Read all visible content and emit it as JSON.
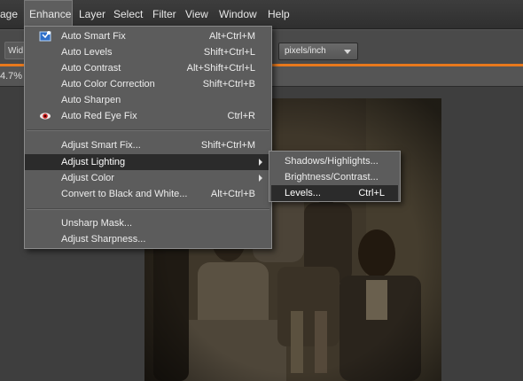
{
  "menubar": {
    "items": [
      {
        "label": "age",
        "active": false
      },
      {
        "label": "Enhance",
        "active": true
      },
      {
        "label": "Layer",
        "active": false
      },
      {
        "label": "Select",
        "active": false
      },
      {
        "label": "Filter",
        "active": false
      },
      {
        "label": "View",
        "active": false
      },
      {
        "label": "Window",
        "active": false
      },
      {
        "label": "Help",
        "active": false
      }
    ]
  },
  "options": {
    "width_label": "Wid",
    "resolution_units": "pixels/inch"
  },
  "tabs": {
    "zoom": "4.7%"
  },
  "enhance_menu": {
    "items": [
      {
        "label": "Auto Smart Fix",
        "shortcut": "Alt+Ctrl+M",
        "icon": "auto-smart-fix-icon"
      },
      {
        "label": "Auto Levels",
        "shortcut": "Shift+Ctrl+L"
      },
      {
        "label": "Auto Contrast",
        "shortcut": "Alt+Shift+Ctrl+L"
      },
      {
        "label": "Auto Color Correction",
        "shortcut": "Shift+Ctrl+B"
      },
      {
        "label": "Auto Sharpen",
        "shortcut": ""
      },
      {
        "label": "Auto Red Eye Fix",
        "shortcut": "Ctrl+R",
        "icon": "red-eye-icon"
      },
      {
        "label": "Adjust Smart Fix...",
        "shortcut": "Shift+Ctrl+M"
      },
      {
        "label": "Adjust Lighting",
        "shortcut": "",
        "submenu": true,
        "highlighted": true
      },
      {
        "label": "Adjust Color",
        "shortcut": "",
        "submenu": true
      },
      {
        "label": "Convert to Black and White...",
        "shortcut": "Alt+Ctrl+B"
      },
      {
        "label": "Unsharp Mask...",
        "shortcut": ""
      },
      {
        "label": "Adjust Sharpness...",
        "shortcut": ""
      }
    ]
  },
  "lighting_submenu": {
    "items": [
      {
        "label": "Shadows/Highlights...",
        "shortcut": ""
      },
      {
        "label": "Brightness/Contrast...",
        "shortcut": ""
      },
      {
        "label": "Levels...",
        "shortcut": "Ctrl+L",
        "highlighted": true
      }
    ]
  },
  "colors": {
    "accent": "#e8791d",
    "menu_bg": "#5c5c5c",
    "highlight": "#2b2b2b"
  }
}
